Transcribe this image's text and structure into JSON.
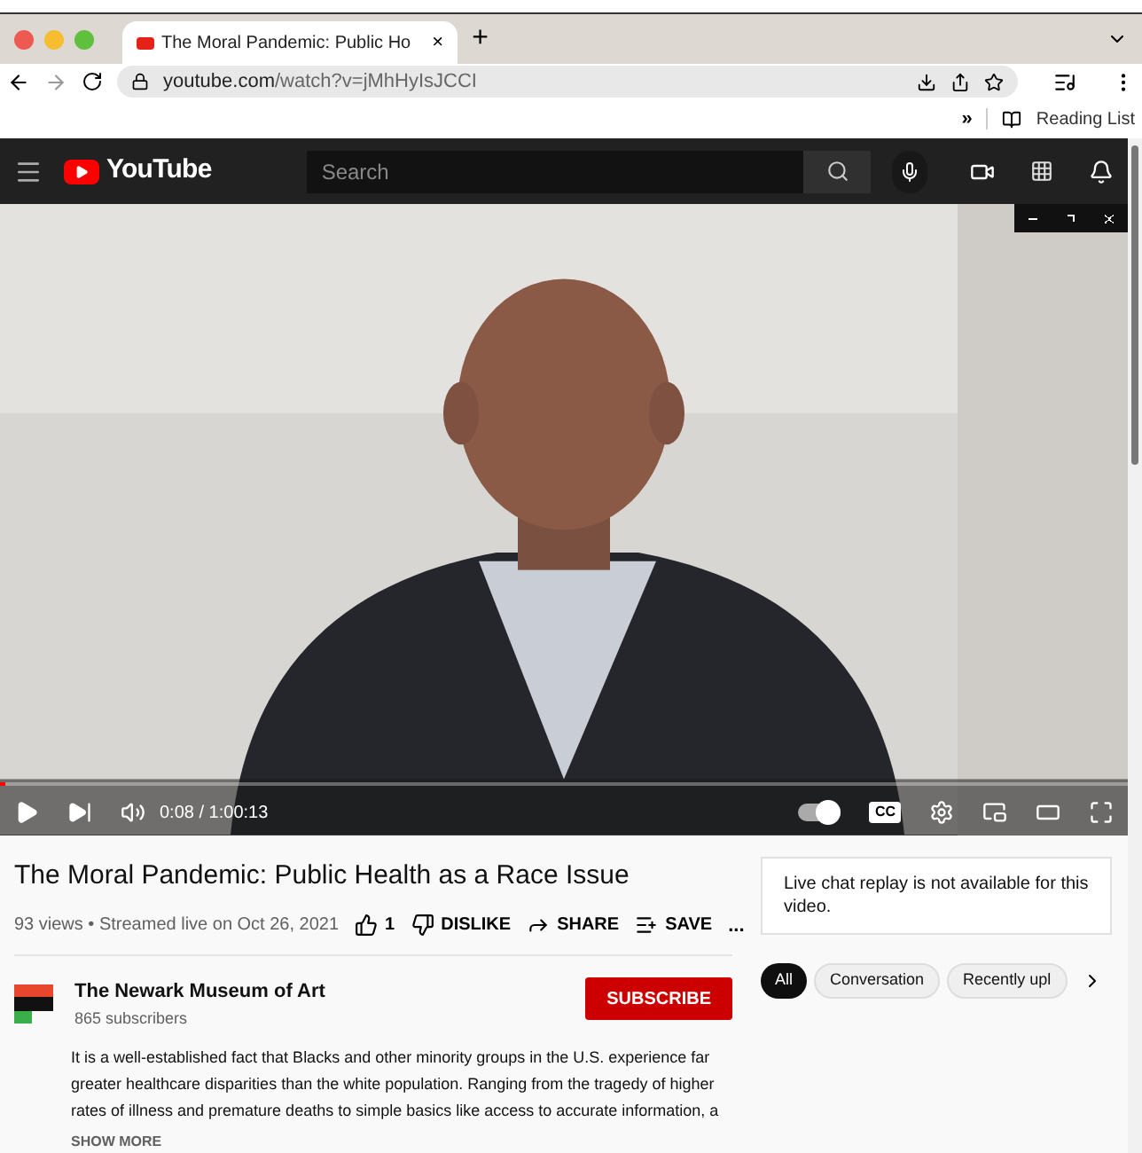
{
  "browser": {
    "tab": {
      "title": "The Moral Pandemic: Public Ho",
      "close": "×"
    },
    "new_tab": "+",
    "url": {
      "host": "youtube.com",
      "path": "/watch?v=jMhHyIsJCCI"
    },
    "bookmarks": {
      "more": "»",
      "reading_list": "Reading List"
    }
  },
  "header": {
    "logo": "YouTube",
    "search": {
      "placeholder": "Search"
    }
  },
  "video": {
    "kind": "picture",
    "progress": {
      "level": 0.004
    },
    "time": "0:08 / 1:00:13",
    "autoplay": {
      "on": true
    },
    "captions": "CC"
  },
  "details": {
    "title": "The Moral Pandemic: Public Health as a Race Issue",
    "meta": "93 views • Streamed live on Oct 26, 2021",
    "likes": "1",
    "actions": [
      "DISLIKE",
      "SHARE",
      "SAVE"
    ],
    "more": "..."
  },
  "channel": {
    "name": "The Newark Museum of Art",
    "subscribers": "865 subscribers",
    "subscribe": "SUBSCRIBE"
  },
  "description": {
    "text": "It is a well-established fact that Blacks and other minority groups in the U.S. experience far greater healthcare disparities than the white population. Ranging from the tragedy of higher rates of illness and premature deaths to simple basics like access to accurate information, a",
    "show_more": "SHOW MORE"
  },
  "chat": {
    "message": "Live chat replay is not available for this video."
  },
  "chips": [
    {
      "label": "All",
      "selected": true
    },
    {
      "label": "Conversation",
      "selected": false
    },
    {
      "label": "Recently upl",
      "selected": false
    }
  ]
}
